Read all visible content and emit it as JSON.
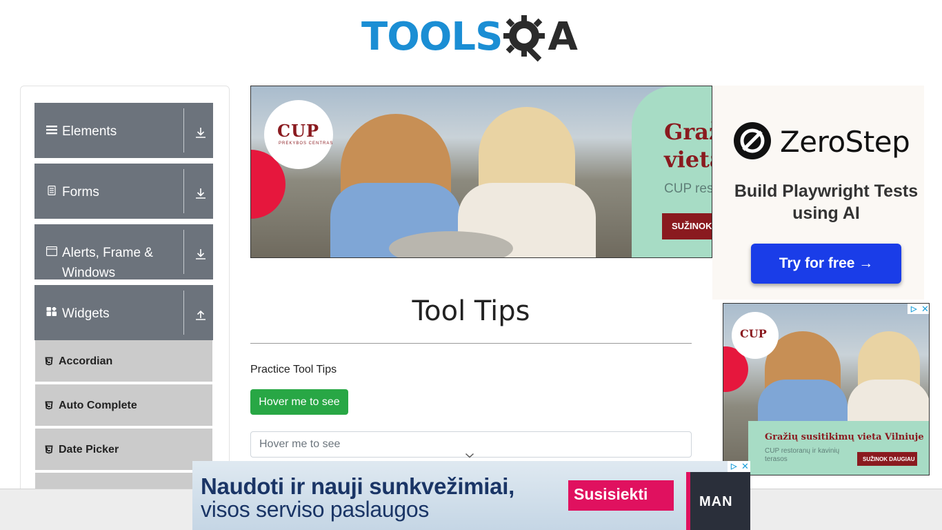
{
  "header": {
    "logo_text": "TOOLS",
    "logo_suffix": "A"
  },
  "sidebar": {
    "groups": [
      {
        "label": "Elements",
        "icon": "list-icon",
        "toggle": "download-icon"
      },
      {
        "label": "Forms",
        "icon": "document-icon",
        "toggle": "download-icon"
      },
      {
        "label": "Alerts, Frame & Windows",
        "icon": "window-icon",
        "toggle": "download-icon"
      },
      {
        "label": "Widgets",
        "icon": "widgets-icon",
        "toggle": "upload-icon"
      }
    ],
    "items": [
      {
        "label": "Accordian",
        "icon": "html5-icon"
      },
      {
        "label": "Auto Complete",
        "icon": "html5-icon"
      },
      {
        "label": "Date Picker",
        "icon": "html5-icon"
      }
    ]
  },
  "main_ad": {
    "brand": "CUP",
    "brand_sub": "PREKYBOS CENTRAS",
    "headline_1": "Graž",
    "headline_2": "vieta",
    "subline": "CUP res",
    "cta": "SUŽINOK"
  },
  "content": {
    "title": "Tool Tips",
    "practice_label": "Practice Tool Tips",
    "hover_button": "Hover me to see",
    "hover_input_placeholder": "Hover me to see"
  },
  "right_ad": {
    "brand": "ZeroStep",
    "tagline": "Build Playwright Tests using AI",
    "cta": "Try for free →"
  },
  "small_ad": {
    "brand": "CUP",
    "headline": "Gražių susitikimų vieta Vilniuje",
    "subline": "CUP restoranų ir kavinių terasos",
    "cta": "SUŽINOK DAUGIAU"
  },
  "bottom_ad": {
    "line1": "Naudoti ir nauji sunkvežimiai,",
    "line2": "visos serviso paslaugos",
    "cta": "Susisiekti",
    "brand": "MAN"
  },
  "colors": {
    "logo_blue": "#1b8ed4",
    "sidebar_group": "#6c737c",
    "sidebar_item": "#cbcbcb",
    "hover_button": "#28a745",
    "zerostep_cta": "#1a3de8",
    "cup_red": "#8a1a1f"
  }
}
